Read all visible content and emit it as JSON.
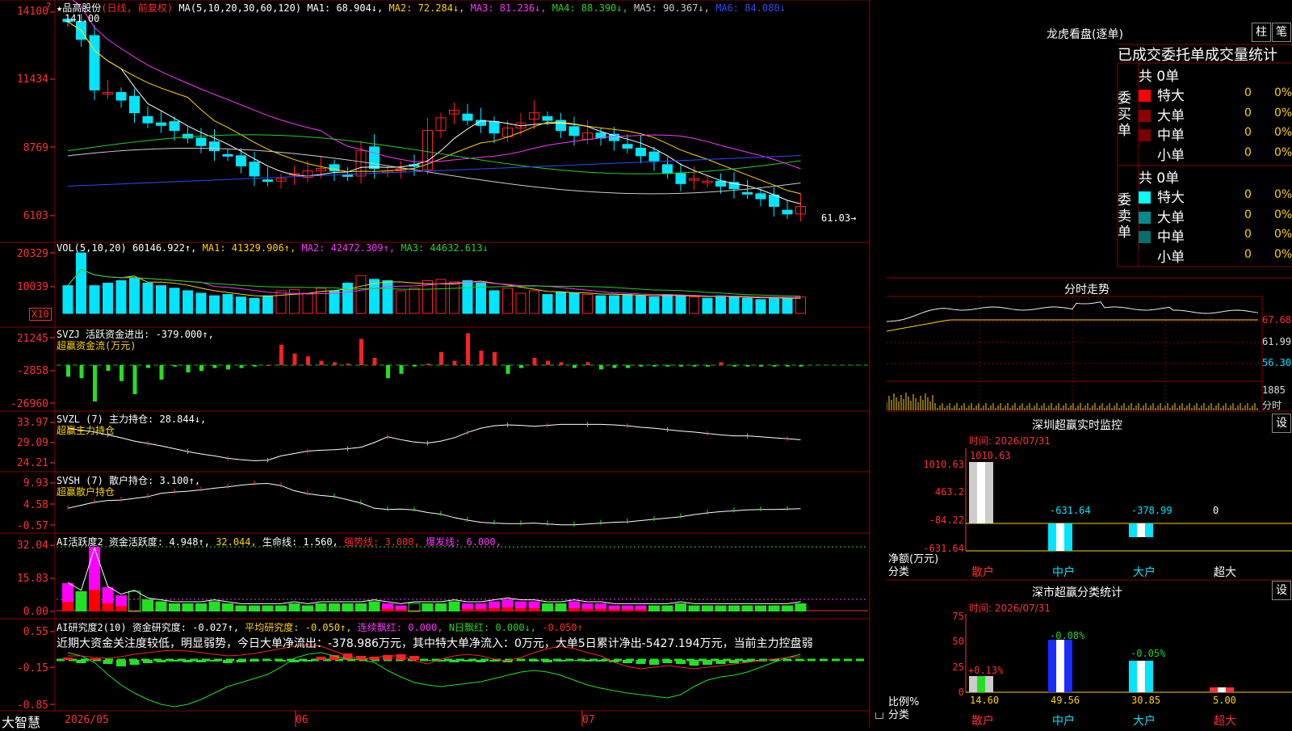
{
  "colors": {
    "up": "#ff2020",
    "down": "#00e5ff",
    "ma1": "#ffffff",
    "ma2": "#ffd400",
    "ma3": "#ff33ff",
    "ma4": "#22d322",
    "ma5": "#cccccc",
    "ma6": "#2a4bff",
    "grid": "#8b0000"
  },
  "header": {
    "stock": "★品高股份",
    "mode": "(日线, 前复权)",
    "ma_label": "MA(5,10,20,30,60,120)",
    "ma1": "MA1: 68.904↓,",
    "ma2": "MA2: 72.284↓,",
    "ma3": "MA3: 81.236↓,",
    "ma4": "MA4: 88.390↓,",
    "ma5": "MA5: 90.367↓,",
    "ma6": "MA6: 84.080↓",
    "high_marker": "141.00",
    "low_marker": "61.03→"
  },
  "price_axis": [
    "14100",
    "11434",
    "8769",
    "6103"
  ],
  "vol": {
    "title": "VOL(5,10,20)",
    "value": "60146.922↑,",
    "ma1": "MA1: 41329.906↑,",
    "ma2": "MA2: 42472.309↑,",
    "ma3": "MA3: 44632.613↓",
    "axis": [
      "20329",
      "10039"
    ],
    "unit": "X10",
    "bars": [
      22,
      48,
      22,
      24,
      26,
      28,
      24,
      22,
      20,
      18,
      16,
      14,
      15,
      13,
      12,
      14,
      18,
      19,
      16,
      20,
      18,
      24,
      30,
      27,
      26,
      18,
      20,
      26,
      27,
      25,
      26,
      24,
      18,
      20,
      16,
      18,
      15,
      17,
      16,
      15,
      14,
      14,
      15,
      14,
      13,
      15,
      14,
      13,
      12,
      14,
      13,
      12,
      11,
      12,
      12,
      13
    ]
  },
  "svzj": {
    "title": "SVZJ  活跃资金进出: -379.000↑,",
    "subtitle": "超赢资金流(万元)",
    "axis": [
      "21245",
      "-2858",
      "-26960"
    ],
    "values": [
      -8,
      -9,
      -25,
      -4,
      -11,
      -20,
      -2,
      -10,
      -1,
      -5,
      -4,
      -2,
      -3,
      -2,
      -1,
      0,
      14,
      8,
      6,
      3,
      2,
      1,
      18,
      5,
      -9,
      -6,
      -1,
      1,
      9,
      3,
      22,
      10,
      9,
      -6,
      -2,
      5,
      3,
      2,
      -2,
      2,
      -3,
      -2,
      -2,
      -1,
      -1,
      -1,
      -1,
      -1,
      -1,
      2,
      -1,
      -1,
      -1,
      -1,
      -1,
      -1
    ],
    "line_color": "#00c000"
  },
  "svzl": {
    "title": "SVZL (7) 主力持仓: 28.844↓,",
    "subtitle": "超赢主力持仓",
    "axis": [
      "33.97",
      "29.09",
      "24.21"
    ],
    "values": [
      31.6,
      31.2,
      30.8,
      30.2,
      29.6,
      28.9,
      28.4,
      27.9,
      27.3,
      26.7,
      26.2,
      25.8,
      25.3,
      25.0,
      24.8,
      24.9,
      25.8,
      26.3,
      26.8,
      27.0,
      27.1,
      27.3,
      27.6,
      28.6,
      29.8,
      29.2,
      28.7,
      28.5,
      28.9,
      29.6,
      30.7,
      31.6,
      32.1,
      32.3,
      32.2,
      32.0,
      32.2,
      32.4,
      32.4,
      32.4,
      32.4,
      32.3,
      32.1,
      31.8,
      31.6,
      31.3,
      31.0,
      30.8,
      30.5,
      30.2,
      30.0,
      30.0,
      29.8,
      29.6,
      29.4,
      29.2
    ]
  },
  "svsh": {
    "title": "SVSH (7) 散户持仓: 3.100↑,",
    "subtitle": "超赢散户持仓",
    "axis": [
      "9.93",
      "4.58",
      "-0.57"
    ],
    "values": [
      3.2,
      3.9,
      4.6,
      5.0,
      5.1,
      5.5,
      5.9,
      6.7,
      7.0,
      7.2,
      7.5,
      7.9,
      8.2,
      8.6,
      8.9,
      9.0,
      8.5,
      7.3,
      6.6,
      6.2,
      5.9,
      5.2,
      4.4,
      3.2,
      2.9,
      3.0,
      2.8,
      2.2,
      1.8,
      1.0,
      0.4,
      -0.1,
      -0.3,
      -0.4,
      -0.4,
      -0.3,
      -0.5,
      -0.7,
      -0.7,
      -0.5,
      -0.3,
      -0.1,
      0.0,
      0.3,
      0.6,
      0.9,
      1.2,
      1.7,
      2.1,
      2.4,
      2.6,
      2.8,
      2.9,
      2.9,
      3.0,
      3.1
    ]
  },
  "ai_active": {
    "title": "AI活跃度2 资金活跃度: 4.948↑,",
    "v2": "32.044,",
    "v3": "生命线: 1.560,",
    "v4": "强势线: 3.000,",
    "v5": "爆发线: 6.000,",
    "axis": [
      "32.04",
      "15.83",
      "0.00"
    ],
    "values": [
      14,
      10,
      32,
      12,
      8,
      10,
      6,
      5,
      4,
      4,
      4,
      5,
      4,
      3,
      3,
      3,
      3,
      4,
      3,
      4,
      4,
      4,
      4,
      5,
      4,
      3,
      4,
      4,
      4,
      5,
      4,
      4,
      5,
      6,
      5,
      5,
      4,
      4,
      5,
      4,
      4,
      3,
      3,
      3,
      3,
      3,
      4,
      3,
      3,
      3,
      3,
      3,
      3,
      3,
      3,
      4
    ],
    "magenta_idx": [
      0,
      2,
      3,
      4,
      24,
      25,
      30,
      31,
      32,
      33,
      34,
      35,
      38,
      39,
      40,
      41,
      42,
      43
    ],
    "outline_idx": [
      5,
      26
    ]
  },
  "ai_research": {
    "title": "AI研究度2(10) 资金研究度: -0.027↑,",
    "v2": "平均研究度: -0.050↑,",
    "v3": "连续飘红: 0.000,",
    "v4": "N日飘红: 0.000↓,",
    "v5": "-0.050↑",
    "axis": [
      "0.55",
      "-0.15",
      "-0.85"
    ],
    "note": "近期大资金关注度较低，明显弱势，今日大单净流出：-378.986万元，其中特大单净流入：0万元，大单5日累计净出-5427.194万元，当前主力控盘弱"
  },
  "xaxis": {
    "d1": "2026/05",
    "d2": "06",
    "d3": "07"
  },
  "brand": "大智慧",
  "lhb": {
    "title": "龙虎看盘(逐单)",
    "btn1": "柱",
    "btn2": "笔",
    "tabs": "已成交委托单成交量统计",
    "buy_total": "共 0单",
    "sell_total": "共 0单",
    "buy_label": "委买单",
    "sell_label": "委卖单",
    "buy_rows": [
      {
        "name": "特大",
        "n": "0",
        "p": "0%",
        "c": "#ff0000"
      },
      {
        "name": "大单",
        "n": "0",
        "p": "0%",
        "c": "#8b0000"
      },
      {
        "name": "中单",
        "n": "0",
        "p": "0%",
        "c": "#7a0000"
      },
      {
        "name": "小单",
        "n": "0",
        "p": "0%",
        "c": "#000000"
      }
    ],
    "sell_rows": [
      {
        "name": "特大",
        "n": "0",
        "p": "0%",
        "c": "#00ffff"
      },
      {
        "name": "大单",
        "n": "0",
        "p": "0%",
        "c": "#008b8b"
      },
      {
        "name": "中单",
        "n": "0",
        "p": "0%",
        "c": "#007070"
      },
      {
        "name": "小单",
        "n": "0",
        "p": "0%",
        "c": "#000000"
      }
    ]
  },
  "intraday": {
    "title": "分时走势",
    "axis": [
      "67.68",
      "61.99",
      "56.30"
    ],
    "vol_axis": [
      "1885",
      "分时"
    ]
  },
  "monitor": {
    "title": "深圳超赢实时监控",
    "btn": "设",
    "time": "时间: 2026/07/31",
    "axis": [
      "1010.63",
      "463.2",
      "-84.22",
      "-631.64"
    ],
    "ylabel1": "净额(万元)",
    "ylabel2": "分类",
    "cats": [
      "散户",
      "中户",
      "大户",
      "超大"
    ],
    "vals": [
      "1010.63",
      "-631.64",
      "-378.99",
      "0"
    ]
  },
  "classstat": {
    "title": "深市超赢分类统计",
    "btn": "设",
    "time": "时间: 2026/07/31",
    "axis": [
      "75",
      "50",
      "25",
      "0"
    ],
    "ylabel1": "比例%",
    "ylabel2": "分类",
    "cats": [
      "散户",
      "中户",
      "大户",
      "超大"
    ],
    "pct": [
      "14.60",
      "49.56",
      "30.85",
      "5.00"
    ],
    "chg": [
      "+0.13%",
      "-0.08%",
      "-0.05%",
      ""
    ]
  }
}
